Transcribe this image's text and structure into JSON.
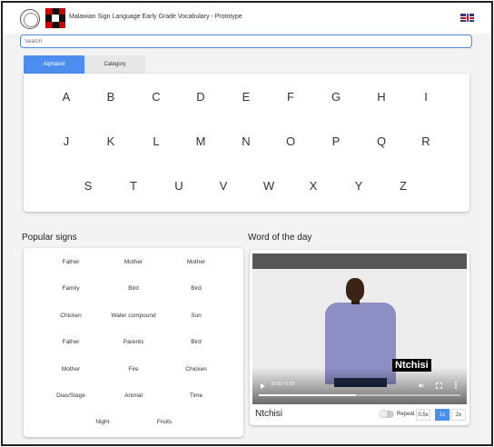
{
  "header": {
    "title": "Malawian Sign Language Early Grade Vocabulary - Prototype",
    "logo_left_icon": "seal-logo-icon",
    "logo_right_icon": "checker-logo-icon",
    "language_flag_icon": "uk-flag-icon"
  },
  "search": {
    "placeholder": "Search",
    "value": ""
  },
  "tabs": [
    {
      "label": "Alphabet",
      "active": true
    },
    {
      "label": "Category",
      "active": false
    }
  ],
  "alphabet": {
    "rows": [
      [
        "A",
        "B",
        "C",
        "D",
        "E",
        "F",
        "G",
        "H",
        "I"
      ],
      [
        "J",
        "K",
        "L",
        "M",
        "N",
        "O",
        "P",
        "Q",
        "R"
      ],
      [
        "S",
        "T",
        "U",
        "V",
        "W",
        "X",
        "Y",
        "Z"
      ]
    ]
  },
  "popular_signs": {
    "title": "Popular signs",
    "rows": [
      [
        "Father",
        "Mother",
        "Mother"
      ],
      [
        "Family",
        "Bird",
        "Bird"
      ],
      [
        "Chicken",
        "Water compound",
        "Sun"
      ],
      [
        "Father",
        "Parents",
        "Bird"
      ],
      [
        "Mother",
        "Fire",
        "Chicken"
      ],
      [
        "Dias/Stage",
        "Animal",
        "Time"
      ],
      [
        "Night",
        "Fruits"
      ]
    ]
  },
  "word_of_the_day": {
    "title": "Word of the day",
    "caption": "Ntchisi",
    "word": "Ntchisi",
    "video_time": "0:00 / 0:07",
    "progress_fraction": 0.48,
    "repeat_label": "Repeat",
    "repeat_on": false,
    "speeds": [
      "0.5x",
      "1x",
      "2x"
    ],
    "active_speed": "1x"
  },
  "colors": {
    "accent": "#4b8ef0",
    "search_border": "#4a8de0"
  }
}
